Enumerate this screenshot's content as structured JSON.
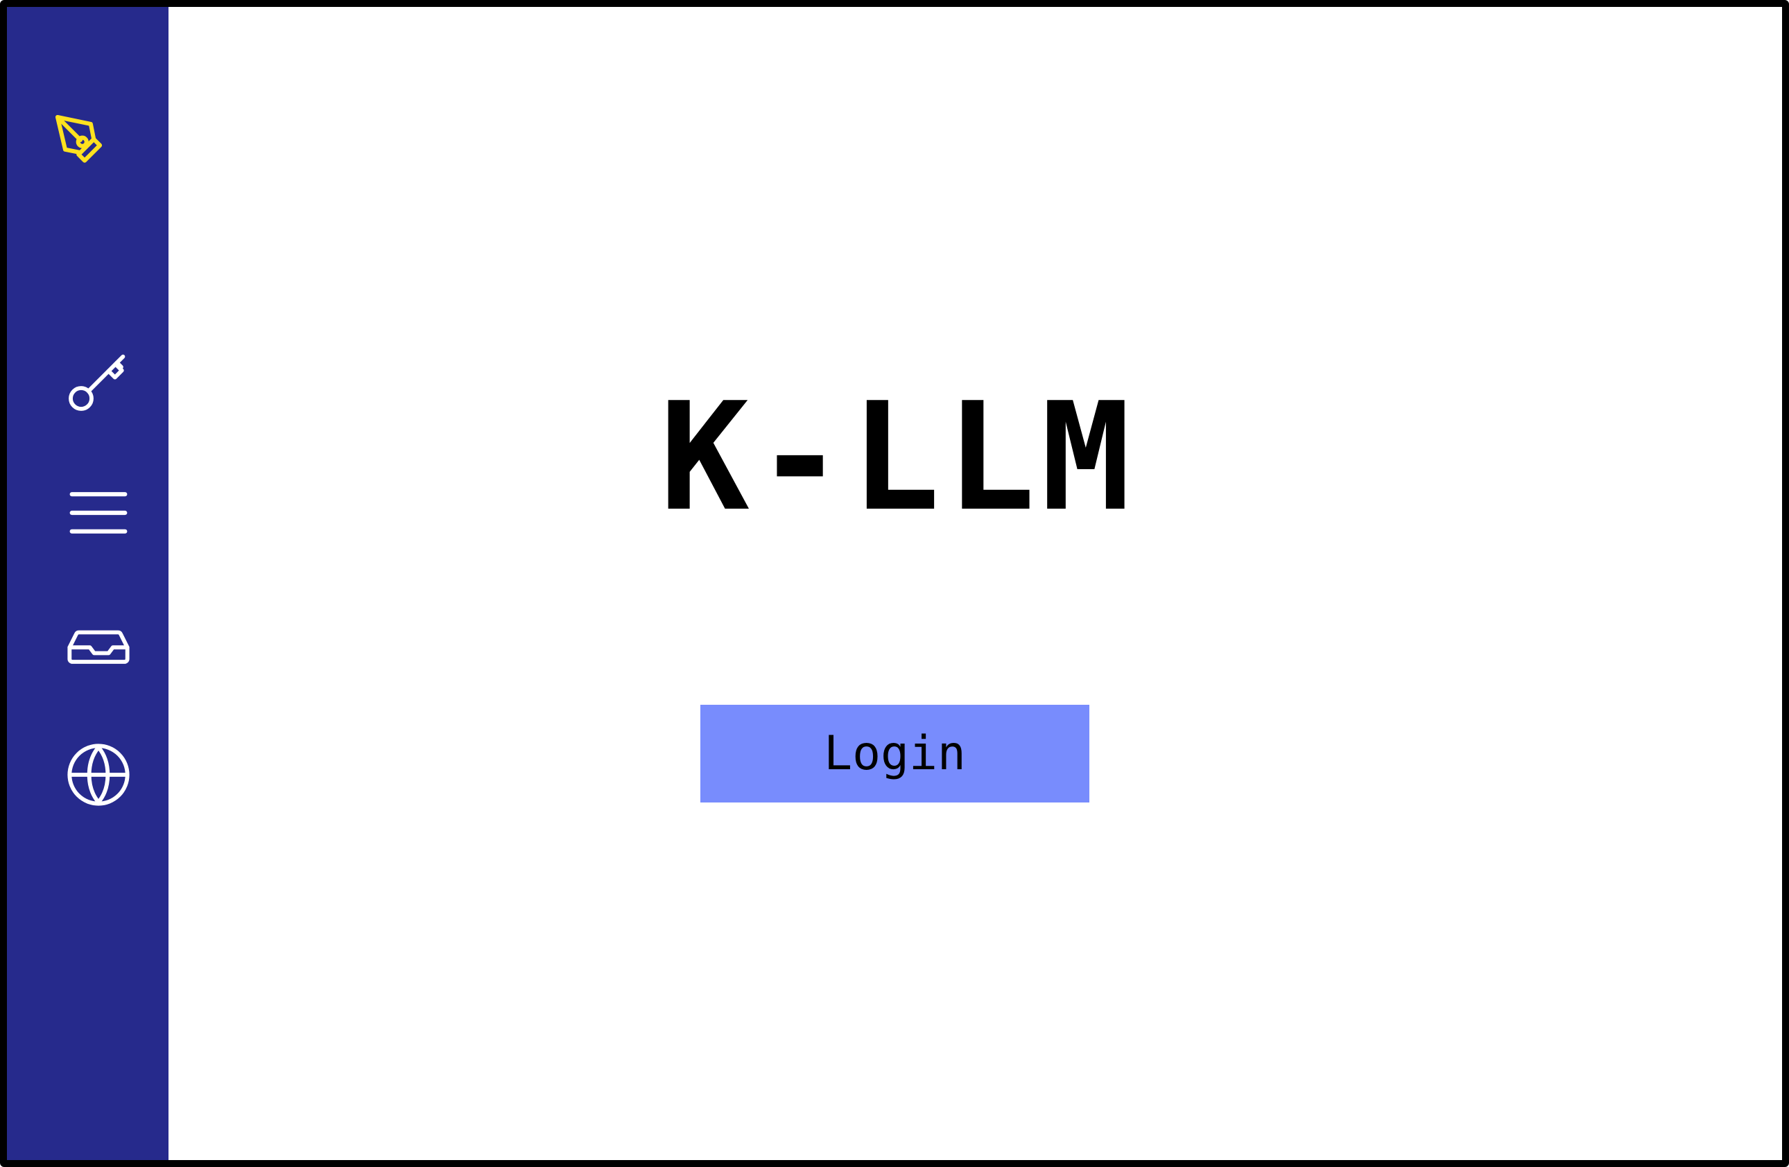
{
  "app": {
    "title": "K-LLM"
  },
  "sidebar": {
    "logo_icon": "pen-nib-icon",
    "items": [
      {
        "icon": "key-icon"
      },
      {
        "icon": "menu-icon"
      },
      {
        "icon": "inbox-icon"
      },
      {
        "icon": "globe-icon"
      }
    ]
  },
  "login": {
    "label": "Login"
  },
  "colors": {
    "sidebar_bg": "#262a8c",
    "logo_accent": "#ffe21f",
    "sidebar_icon": "#ffffff",
    "button_bg": "#788cfd",
    "text": "#000000",
    "background": "#ffffff"
  }
}
